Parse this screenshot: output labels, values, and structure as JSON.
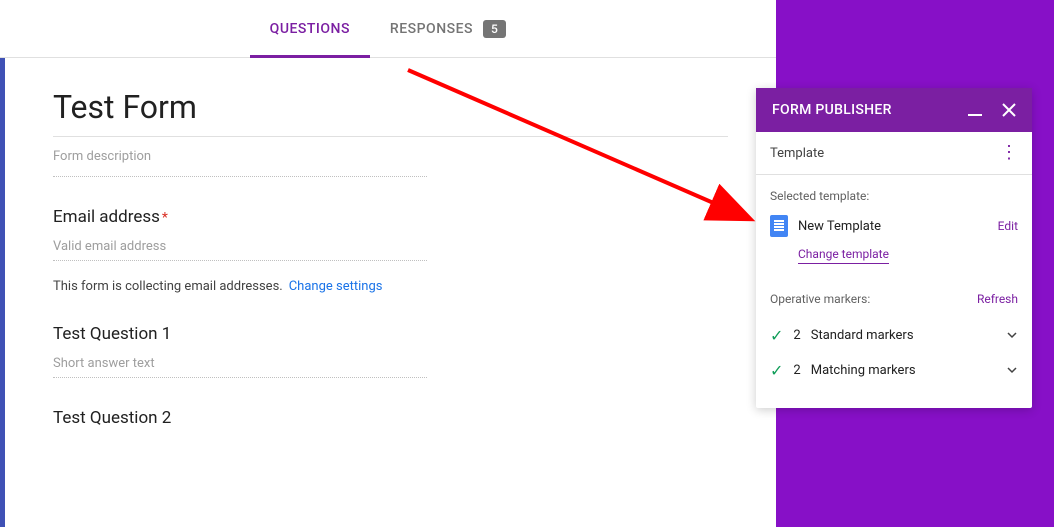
{
  "tabs": {
    "questions": "QUESTIONS",
    "responses": "RESPONSES",
    "response_count": "5"
  },
  "form": {
    "title": "Test Form",
    "description_placeholder": "Form description",
    "email_label": "Email address",
    "email_placeholder": "Valid email address",
    "collecting_text": "This form is collecting email addresses.",
    "change_settings": "Change settings",
    "question1_label": "Test Question 1",
    "short_answer_placeholder": "Short answer text",
    "question2_label": "Test Question 2"
  },
  "addon": {
    "title": "FORM PUBLISHER",
    "subheader": "Template",
    "selected_template_label": "Selected template:",
    "template_name": "New Template",
    "edit": "Edit",
    "change_template": "Change template",
    "operative_markers_label": "Operative markers:",
    "refresh": "Refresh",
    "marker_standard_count": "2",
    "marker_standard_label": "Standard markers",
    "marker_matching_count": "2",
    "marker_matching_label": "Matching markers"
  }
}
